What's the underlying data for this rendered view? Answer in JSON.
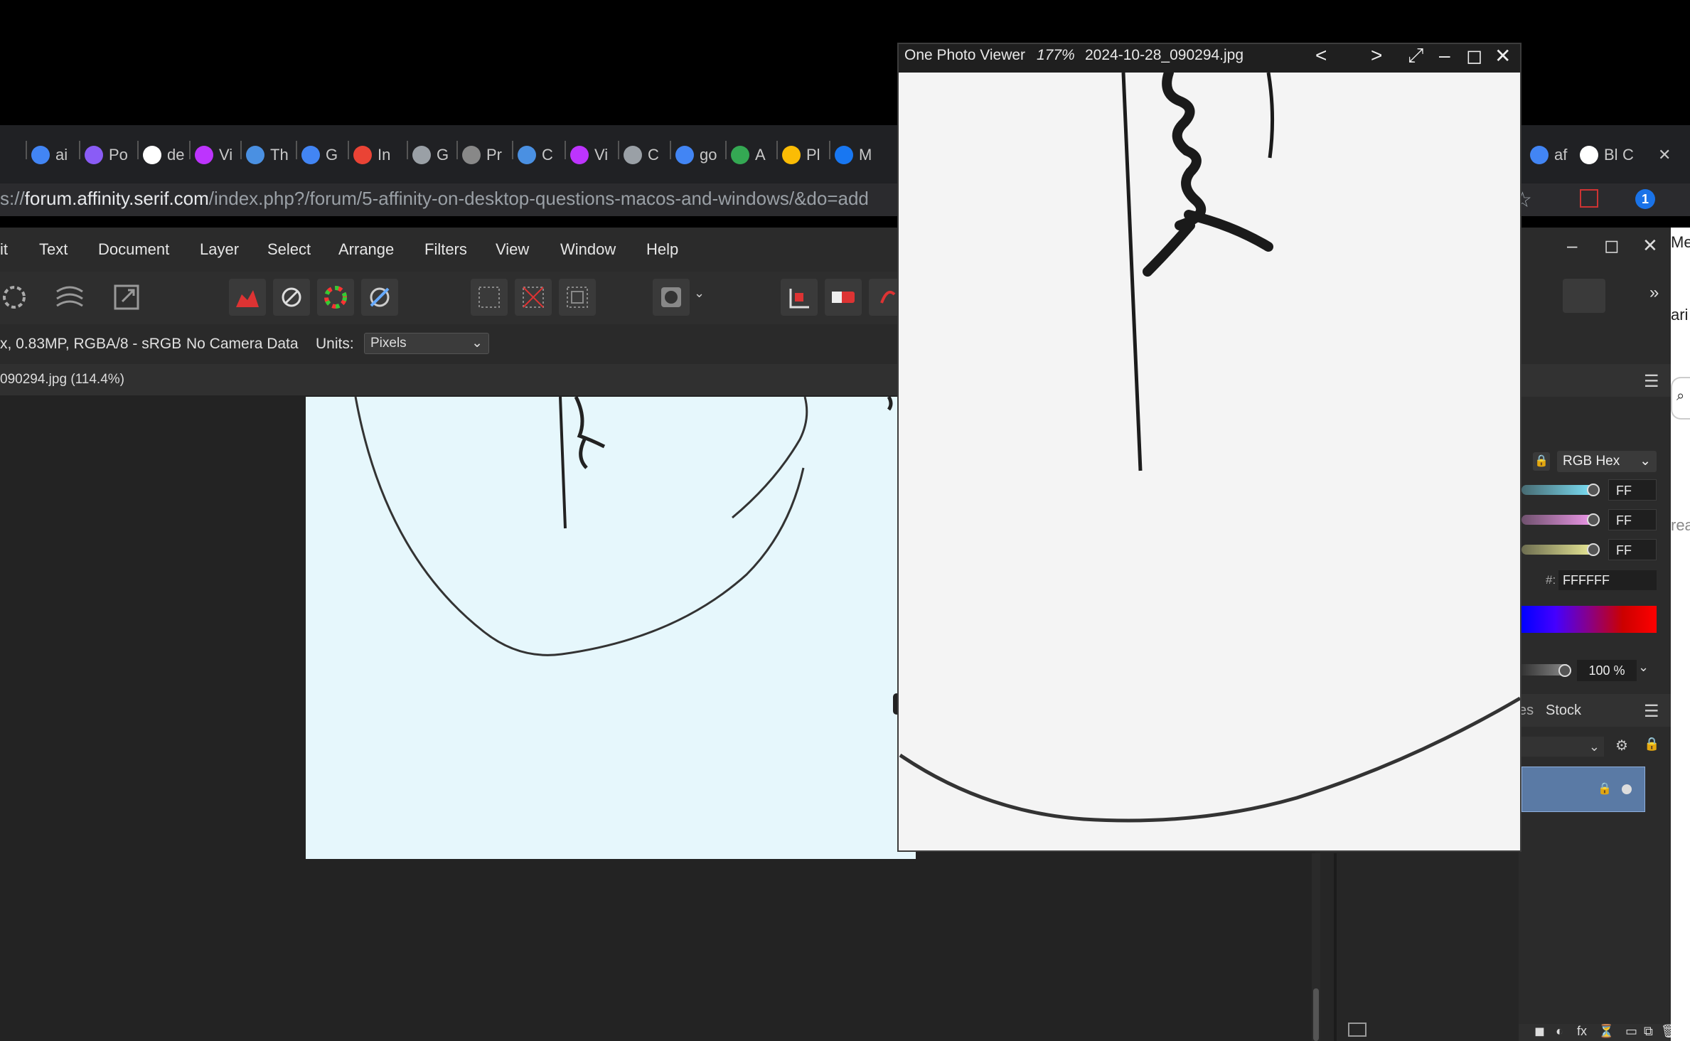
{
  "browser": {
    "tabs": [
      {
        "icon": "google-icon",
        "label": "ai",
        "color": "#4285f4"
      },
      {
        "icon": "orb-icon",
        "label": "Po",
        "color": "#8a5cf6"
      },
      {
        "icon": "github-icon",
        "label": "de",
        "color": "#ffffff"
      },
      {
        "icon": "vite-icon",
        "label": "Vi",
        "color": "#bd34fe"
      },
      {
        "icon": "diamond-icon",
        "label": "Th",
        "color": "#4a90e2"
      },
      {
        "icon": "calendar-icon",
        "label": "G",
        "color": "#4285f4"
      },
      {
        "icon": "gmail-icon",
        "label": "In",
        "color": "#ea4335"
      },
      {
        "icon": "doc-icon",
        "label": "G",
        "color": "#9aa0a6"
      },
      {
        "icon": "outlook-icon",
        "label": "Pr",
        "color": "#888888"
      },
      {
        "icon": "headset-icon",
        "label": "C",
        "color": "#4a90e2"
      },
      {
        "icon": "vite-icon",
        "label": "Vi",
        "color": "#bd34fe"
      },
      {
        "icon": "doc-icon",
        "label": "C",
        "color": "#9aa0a6"
      },
      {
        "icon": "google-icon",
        "label": "go",
        "color": "#4285f4"
      },
      {
        "icon": "maps-icon",
        "label": "A",
        "color": "#34a853"
      },
      {
        "icon": "pinwheel-icon",
        "label": "Pl",
        "color": "#fbbc05"
      },
      {
        "icon": "facebook-icon",
        "label": "M",
        "color": "#1877f2"
      }
    ],
    "tabs_right": [
      {
        "icon": "google-icon",
        "label": "af",
        "color": "#4285f4"
      },
      {
        "icon": "drive-icon",
        "label": "Bl",
        "color": "#ffffff"
      },
      {
        "icon": "",
        "label": "C",
        "color": "#cccccc"
      }
    ],
    "url_prefix": "s://",
    "url_host": "forum.affinity.serif.com",
    "url_path": "/index.php?/forum/5-affinity-on-desktop-questions-macos-and-windows/&do=add",
    "page_text_1": "Me",
    "page_text_2": "ari",
    "page_text_3": "rea"
  },
  "app": {
    "menu": [
      "it",
      "Text",
      "Document",
      "Layer",
      "Select",
      "Arrange",
      "Filters",
      "View",
      "Window",
      "Help"
    ],
    "context": {
      "info": "x, 0.83MP, RGBA/8 - sRGB",
      "camera": "No Camera Data",
      "units_label": "Units:",
      "units_value": "Pixels"
    },
    "document_tab": "090294.jpg (114.4%)"
  },
  "color_panel": {
    "mode": "RGB Hex",
    "channels": [
      {
        "value": "FF",
        "color": "#7fe8ff"
      },
      {
        "value": "FF",
        "color": "#f59cf0"
      },
      {
        "value": "FF",
        "color": "#f0f09a"
      }
    ],
    "hex_label": "#:",
    "hex_value": "FFFFFF",
    "opacity": "100 %"
  },
  "layers_panel": {
    "tab_partial": "es",
    "tab_stock": "Stock"
  },
  "viewer": {
    "app_name": "One Photo Viewer",
    "zoom": "177%",
    "filename": "2024-10-28_090294.jpg"
  }
}
